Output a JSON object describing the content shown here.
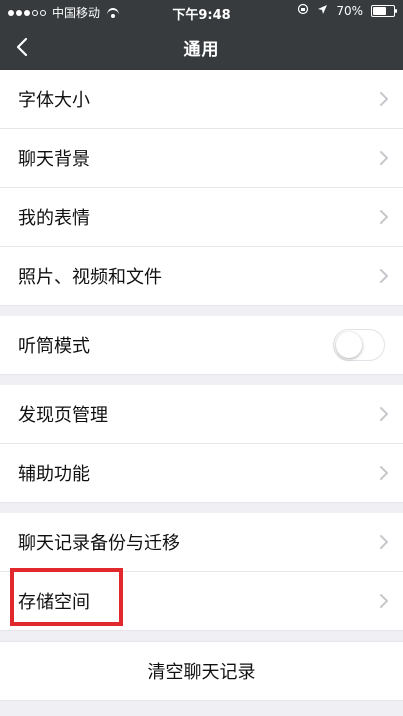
{
  "status_bar": {
    "carrier": "中国移动",
    "time": "下午9:48",
    "battery_percent": "70%",
    "battery_level": 0.7
  },
  "nav": {
    "title": "通用"
  },
  "sections": [
    {
      "items": [
        {
          "label": "字体大小"
        },
        {
          "label": "聊天背景"
        },
        {
          "label": "我的表情"
        },
        {
          "label": "照片、视频和文件"
        }
      ]
    },
    {
      "items": [
        {
          "label": "听筒模式",
          "toggle": false
        }
      ]
    },
    {
      "items": [
        {
          "label": "发现页管理"
        },
        {
          "label": "辅助功能"
        }
      ]
    },
    {
      "items": [
        {
          "label": "聊天记录备份与迁移"
        },
        {
          "label": "存储空间"
        }
      ]
    }
  ],
  "clear_chat": {
    "label": "清空聊天记录"
  },
  "colors": {
    "top_bar": "#373b3e",
    "background": "#efeff4",
    "highlight": "#e0282d"
  },
  "icons": {
    "back": "chevron-left-icon",
    "row_chevron": "chevron-right-icon",
    "wifi": "wifi-icon",
    "battery": "battery-icon",
    "location": "location-arrow-icon",
    "lock_rotation": "orientation-lock-icon"
  }
}
